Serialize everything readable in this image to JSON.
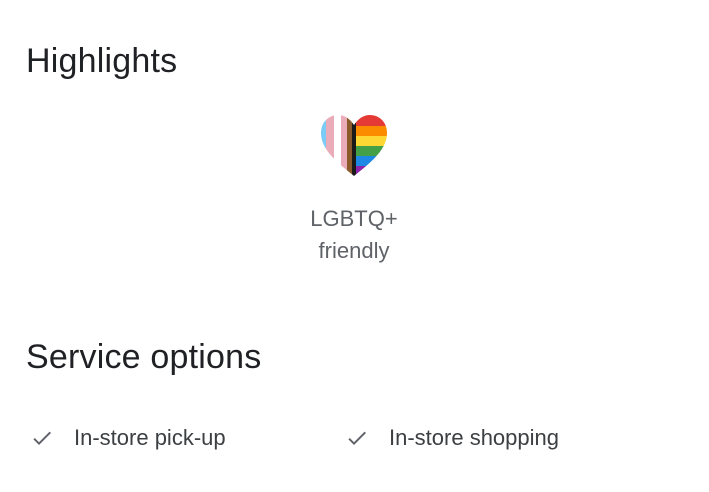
{
  "highlights": {
    "title": "Highlights",
    "items": [
      {
        "icon": "pride-heart-icon",
        "label_line1": "LGBTQ+",
        "label_line2": "friendly"
      }
    ]
  },
  "service_options": {
    "title": "Service options",
    "items": [
      {
        "icon": "checkmark-icon",
        "label": "In-store pick-up"
      },
      {
        "icon": "checkmark-icon",
        "label": "In-store shopping"
      }
    ]
  },
  "colors": {
    "heading": "#202124",
    "secondary_text": "#5f6368",
    "body_text": "#3c4043",
    "check": "#5f6368"
  }
}
